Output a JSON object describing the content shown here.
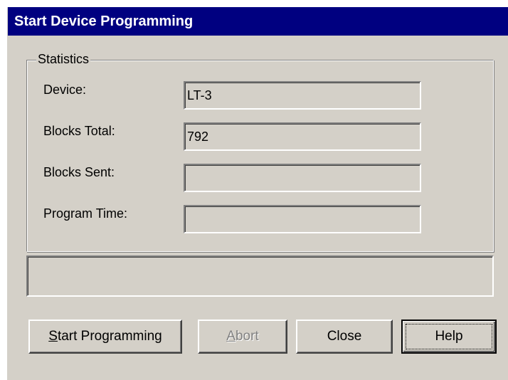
{
  "window": {
    "title": "Start Device Programming"
  },
  "statistics": {
    "group_label": "Statistics",
    "rows": [
      {
        "label": "Device:",
        "value": "LT-3"
      },
      {
        "label": "Blocks Total:",
        "value": "792"
      },
      {
        "label": "Blocks Sent:",
        "value": ""
      },
      {
        "label": "Program Time:",
        "value": ""
      }
    ]
  },
  "status_panel": {
    "text": ""
  },
  "buttons": {
    "start_programming": {
      "mnemonic": "S",
      "rest": "tart Programming",
      "enabled": true
    },
    "abort": {
      "mnemonic": "A",
      "rest": "bort",
      "enabled": false
    },
    "close": {
      "label": "Close",
      "enabled": true
    },
    "help": {
      "label": "Help",
      "enabled": true,
      "focused": true
    }
  },
  "colors": {
    "title_bar": "#000080",
    "face": "#d4d0c8",
    "disabled_text": "#808080"
  }
}
